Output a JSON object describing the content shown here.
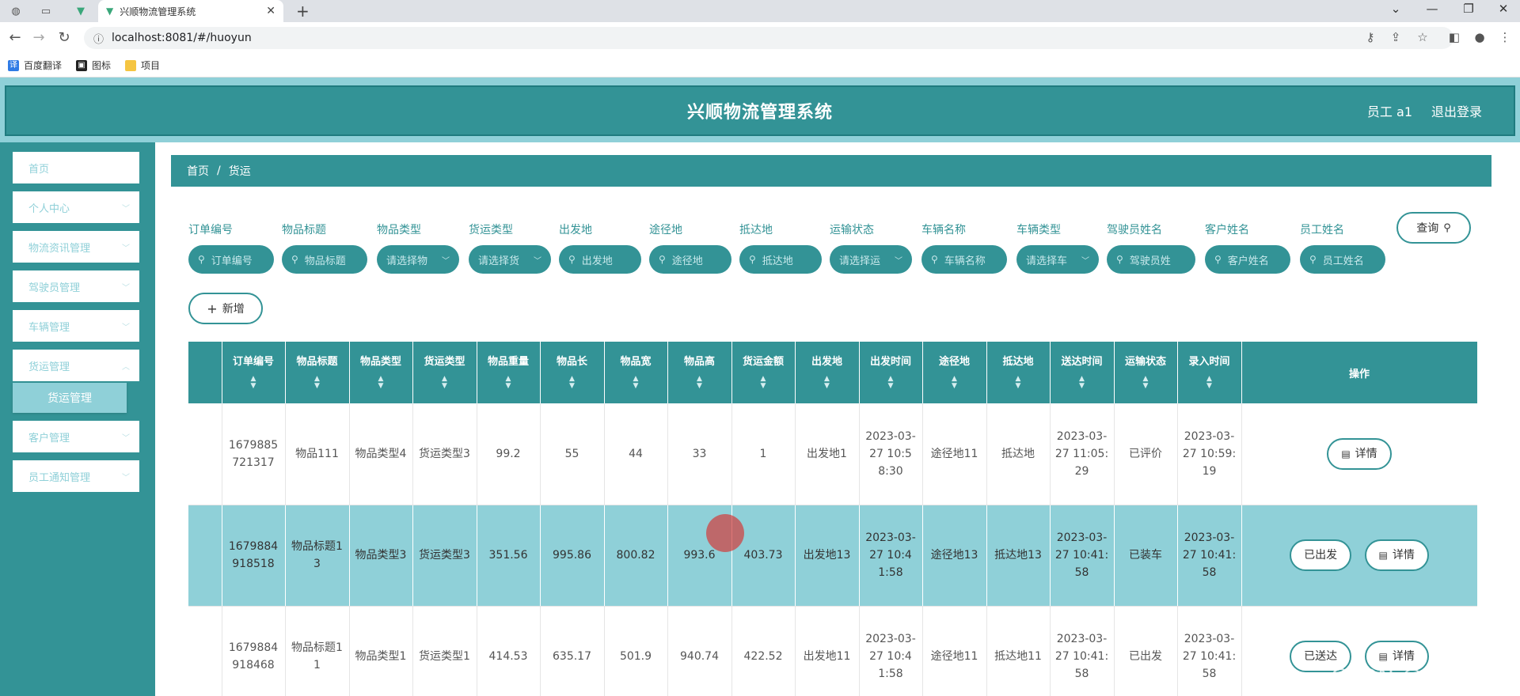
{
  "browser": {
    "tab_title": "兴顺物流管理系统",
    "url": "localhost:8081/#/huoyun",
    "bookmarks": [
      "百度翻译",
      "图标",
      "项目"
    ]
  },
  "header": {
    "title": "兴顺物流管理系统",
    "user": "员工 a1",
    "logout": "退出登录"
  },
  "sidebar": {
    "items": [
      "首页",
      "个人中心",
      "物流资讯管理",
      "驾驶员管理",
      "车辆管理",
      "货运管理",
      "客户管理",
      "员工通知管理"
    ],
    "submenu": "货运管理"
  },
  "breadcrumb": {
    "home": "首页",
    "sep": "/",
    "current": "货运"
  },
  "filters": [
    {
      "label": "订单编号",
      "placeholder": "订单编号"
    },
    {
      "label": "物品标题",
      "placeholder": "物品标题"
    },
    {
      "label": "物品类型",
      "placeholder": "请选择物"
    },
    {
      "label": "货运类型",
      "placeholder": "请选择货"
    },
    {
      "label": "出发地",
      "placeholder": "出发地"
    },
    {
      "label": "途径地",
      "placeholder": "途径地"
    },
    {
      "label": "抵达地",
      "placeholder": "抵达地"
    },
    {
      "label": "运输状态",
      "placeholder": "请选择运"
    },
    {
      "label": "车辆名称",
      "placeholder": "车辆名称"
    },
    {
      "label": "车辆类型",
      "placeholder": "请选择车"
    },
    {
      "label": "驾驶员姓名",
      "placeholder": "驾驶员姓"
    },
    {
      "label": "客户姓名",
      "placeholder": "客户姓名"
    },
    {
      "label": "员工姓名",
      "placeholder": "员工姓名"
    }
  ],
  "buttons": {
    "query": "查询",
    "add": "新增"
  },
  "table": {
    "columns": [
      "订单编号",
      "物品标题",
      "物品类型",
      "货运类型",
      "物品重量",
      "物品长",
      "物品宽",
      "物品高",
      "货运金额",
      "出发地",
      "出发时间",
      "途径地",
      "抵达地",
      "送达时间",
      "运输状态",
      "录入时间",
      "操作"
    ],
    "rows": [
      {
        "cells": [
          "1679885721317",
          "物品111",
          "物品类型4",
          "货运类型3",
          "99.2",
          "55",
          "44",
          "33",
          "1",
          "出发地1",
          "2023-03-27 10:58:30",
          "途径地11",
          "抵达地",
          "2023-03-27 11:05:29",
          "已评价",
          "2023-03-27 10:59:19"
        ],
        "actions": [
          "详情"
        ]
      },
      {
        "cells": [
          "1679884918518",
          "物品标题13",
          "物品类型3",
          "货运类型3",
          "351.56",
          "995.86",
          "800.82",
          "993.6",
          "403.73",
          "出发地13",
          "2023-03-27 10:41:58",
          "途径地13",
          "抵达地13",
          "2023-03-27 10:41:58",
          "已装车",
          "2023-03-27 10:41:58"
        ],
        "actions": [
          "已出发",
          "详情"
        ]
      },
      {
        "cells": [
          "1679884918468",
          "物品标题11",
          "物品类型1",
          "货运类型1",
          "414.53",
          "635.17",
          "501.9",
          "940.74",
          "422.52",
          "出发地11",
          "2023-03-27 10:41:58",
          "途径地11",
          "抵达地11",
          "2023-03-27 10:41:58",
          "已出发",
          "2023-03-27 10:41:58"
        ],
        "actions": [
          "已送达",
          "详情"
        ]
      }
    ]
  },
  "watermark": "CSDN @木罗毕设"
}
